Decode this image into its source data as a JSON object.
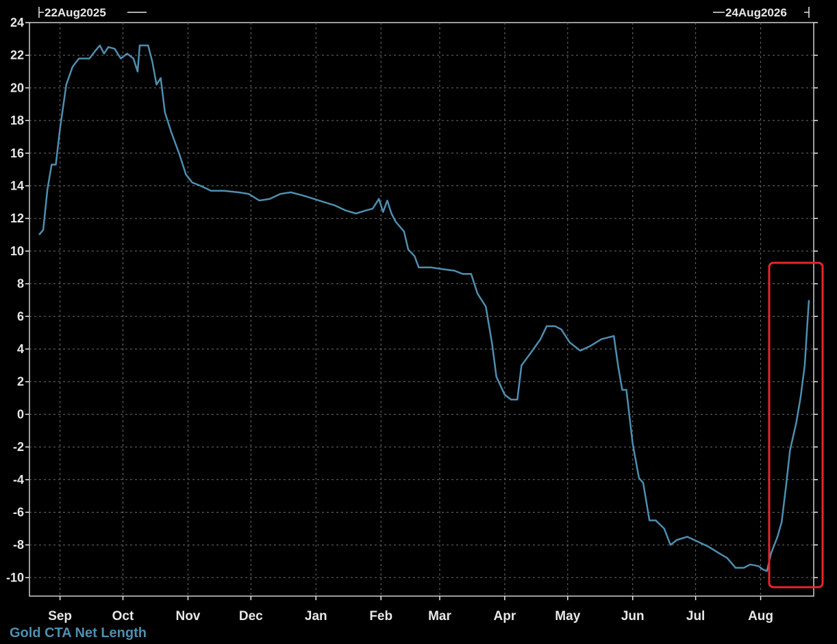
{
  "chart_data": {
    "type": "line",
    "title": "",
    "xlabel": "",
    "ylabel": "",
    "start_label": "22Aug2025",
    "end_label": "24Aug2026",
    "ylim": [
      -11,
      24
    ],
    "yticks": [
      24,
      22,
      20,
      18,
      16,
      14,
      12,
      10,
      8,
      6,
      4,
      2,
      0,
      -2,
      -4,
      -6,
      -8,
      -10
    ],
    "month_ticks": [
      {
        "label": "Sep",
        "date": "2025-09-01"
      },
      {
        "label": "Oct",
        "date": "2025-10-01"
      },
      {
        "label": "Nov",
        "date": "2025-11-01"
      },
      {
        "label": "Dec",
        "date": "2025-12-01"
      },
      {
        "label": "Jan",
        "date": "2026-01-01"
      },
      {
        "label": "Feb",
        "date": "2026-02-01"
      },
      {
        "label": "Mar",
        "date": "2026-03-01"
      },
      {
        "label": "Apr",
        "date": "2026-04-01"
      },
      {
        "label": "May",
        "date": "2026-05-01"
      },
      {
        "label": "Jun",
        "date": "2026-06-01"
      },
      {
        "label": "Jul",
        "date": "2026-07-01"
      },
      {
        "label": "Aug",
        "date": "2026-08-01"
      }
    ],
    "grid": true,
    "colors": {
      "line": "#4f8fb0",
      "highlight": "#e8262a",
      "text": "#e8e8e8",
      "grid": "#6e6e6e"
    },
    "series": [
      {
        "name": "Gold CTA Net Length",
        "points": [
          [
            "2025-08-22",
            11.0
          ],
          [
            "2025-08-24",
            11.3
          ],
          [
            "2025-08-26",
            13.8
          ],
          [
            "2025-08-28",
            15.3
          ],
          [
            "2025-08-30",
            15.3
          ],
          [
            "2025-09-01",
            17.5
          ],
          [
            "2025-09-04",
            20.2
          ],
          [
            "2025-09-07",
            21.3
          ],
          [
            "2025-09-10",
            21.8
          ],
          [
            "2025-09-15",
            21.8
          ],
          [
            "2025-09-18",
            22.3
          ],
          [
            "2025-09-20",
            22.6
          ],
          [
            "2025-09-22",
            22.1
          ],
          [
            "2025-09-24",
            22.5
          ],
          [
            "2025-09-27",
            22.4
          ],
          [
            "2025-09-30",
            21.8
          ],
          [
            "2025-10-03",
            22.1
          ],
          [
            "2025-10-06",
            21.8
          ],
          [
            "2025-10-08",
            21.0
          ],
          [
            "2025-10-09",
            22.6
          ],
          [
            "2025-10-13",
            22.6
          ],
          [
            "2025-10-15",
            21.6
          ],
          [
            "2025-10-17",
            20.2
          ],
          [
            "2025-10-19",
            20.6
          ],
          [
            "2025-10-21",
            18.5
          ],
          [
            "2025-10-24",
            17.3
          ],
          [
            "2025-10-28",
            15.9
          ],
          [
            "2025-10-31",
            14.7
          ],
          [
            "2025-11-03",
            14.2
          ],
          [
            "2025-11-07",
            14.0
          ],
          [
            "2025-11-12",
            13.7
          ],
          [
            "2025-11-18",
            13.7
          ],
          [
            "2025-11-25",
            13.6
          ],
          [
            "2025-11-30",
            13.5
          ],
          [
            "2025-12-05",
            13.1
          ],
          [
            "2025-12-10",
            13.2
          ],
          [
            "2025-12-15",
            13.5
          ],
          [
            "2025-12-20",
            13.6
          ],
          [
            "2025-12-26",
            13.4
          ],
          [
            "2025-12-31",
            13.2
          ],
          [
            "2026-01-05",
            13.0
          ],
          [
            "2026-01-10",
            12.8
          ],
          [
            "2026-01-15",
            12.5
          ],
          [
            "2026-01-20",
            12.3
          ],
          [
            "2026-01-25",
            12.5
          ],
          [
            "2026-01-28",
            12.6
          ],
          [
            "2026-01-31",
            13.2
          ],
          [
            "2026-02-02",
            12.4
          ],
          [
            "2026-02-04",
            13.1
          ],
          [
            "2026-02-06",
            12.3
          ],
          [
            "2026-02-08",
            11.8
          ],
          [
            "2026-02-12",
            11.2
          ],
          [
            "2026-02-14",
            10.1
          ],
          [
            "2026-02-17",
            9.7
          ],
          [
            "2026-02-19",
            9.0
          ],
          [
            "2026-02-25",
            9.0
          ],
          [
            "2026-03-02",
            8.9
          ],
          [
            "2026-03-08",
            8.8
          ],
          [
            "2026-03-12",
            8.6
          ],
          [
            "2026-03-16",
            8.6
          ],
          [
            "2026-03-19",
            7.4
          ],
          [
            "2026-03-23",
            6.6
          ],
          [
            "2026-03-26",
            4.3
          ],
          [
            "2026-03-28",
            2.3
          ],
          [
            "2026-04-01",
            1.2
          ],
          [
            "2026-04-04",
            0.9
          ],
          [
            "2026-04-07",
            0.9
          ],
          [
            "2026-04-09",
            3.0
          ],
          [
            "2026-04-13",
            3.7
          ],
          [
            "2026-04-18",
            4.6
          ],
          [
            "2026-04-21",
            5.4
          ],
          [
            "2026-04-25",
            5.4
          ],
          [
            "2026-04-28",
            5.2
          ],
          [
            "2026-05-02",
            4.4
          ],
          [
            "2026-05-07",
            3.9
          ],
          [
            "2026-05-12",
            4.2
          ],
          [
            "2026-05-17",
            4.6
          ],
          [
            "2026-05-20",
            4.7
          ],
          [
            "2026-05-23",
            4.8
          ],
          [
            "2026-05-25",
            3.0
          ],
          [
            "2026-05-27",
            1.5
          ],
          [
            "2026-05-29",
            1.5
          ],
          [
            "2026-06-01",
            -1.8
          ],
          [
            "2026-06-04",
            -3.9
          ],
          [
            "2026-06-06",
            -4.2
          ],
          [
            "2026-06-09",
            -6.5
          ],
          [
            "2026-06-12",
            -6.5
          ],
          [
            "2026-06-16",
            -7.0
          ],
          [
            "2026-06-19",
            -8.0
          ],
          [
            "2026-06-22",
            -7.7
          ],
          [
            "2026-06-27",
            -7.5
          ],
          [
            "2026-07-02",
            -7.8
          ],
          [
            "2026-07-07",
            -8.1
          ],
          [
            "2026-07-12",
            -8.5
          ],
          [
            "2026-07-16",
            -8.8
          ],
          [
            "2026-07-20",
            -9.4
          ],
          [
            "2026-07-24",
            -9.4
          ],
          [
            "2026-07-27",
            -9.2
          ],
          [
            "2026-07-31",
            -9.3
          ],
          [
            "2026-08-02",
            -9.5
          ],
          [
            "2026-08-04",
            -9.6
          ],
          [
            "2026-08-06",
            -8.5
          ],
          [
            "2026-08-09",
            -7.5
          ],
          [
            "2026-08-11",
            -6.6
          ],
          [
            "2026-08-13",
            -4.5
          ],
          [
            "2026-08-15",
            -2.2
          ],
          [
            "2026-08-18",
            -0.5
          ],
          [
            "2026-08-20",
            1.0
          ],
          [
            "2026-08-22",
            3.0
          ],
          [
            "2026-08-23",
            5.0
          ],
          [
            "2026-08-24",
            7.0
          ]
        ]
      }
    ]
  }
}
